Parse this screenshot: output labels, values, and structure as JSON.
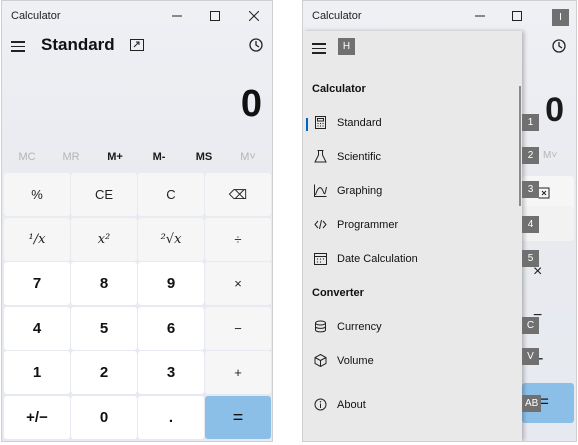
{
  "left": {
    "title": "Calculator",
    "mode": "Standard",
    "display": "0",
    "memory": [
      {
        "label": "MC",
        "enabled": false
      },
      {
        "label": "MR",
        "enabled": false
      },
      {
        "label": "M+",
        "enabled": true
      },
      {
        "label": "M-",
        "enabled": true
      },
      {
        "label": "MS",
        "enabled": true
      },
      {
        "label": "M˅",
        "enabled": false
      }
    ],
    "keys": [
      [
        "%",
        "CE",
        "C",
        "⌫"
      ],
      [
        "¹∕x",
        "x²",
        "²√x",
        "÷"
      ],
      [
        "7",
        "8",
        "9",
        "×"
      ],
      [
        "4",
        "5",
        "6",
        "−"
      ],
      [
        "1",
        "2",
        "3",
        "+"
      ],
      [
        "+/−",
        "0",
        ".",
        "="
      ]
    ]
  },
  "right": {
    "title": "Calculator",
    "display": "0",
    "mem_label": "M˅",
    "nav": {
      "sections": {
        "calculator": "Calculator",
        "converter": "Converter"
      },
      "items": [
        {
          "label": "Standard",
          "icon": "standard-calculator-icon",
          "selected": true
        },
        {
          "label": "Scientific",
          "icon": "flask-icon"
        },
        {
          "label": "Graphing",
          "icon": "graph-icon"
        },
        {
          "label": "Programmer",
          "icon": "code-icon"
        },
        {
          "label": "Date Calculation",
          "icon": "calendar-icon"
        }
      ],
      "converter_items": [
        {
          "label": "Currency",
          "icon": "coins-icon"
        },
        {
          "label": "Volume",
          "icon": "cube-icon"
        }
      ],
      "about": "About"
    },
    "badges": {
      "close": "I",
      "hamburger": "H",
      "b1": "1",
      "b2": "2",
      "b3": "3",
      "b4": "4",
      "b5": "5",
      "bC": "C",
      "bV": "V",
      "bAB": "AB"
    },
    "key_glyphs": {
      "times": "×",
      "minus": "−",
      "plus": "+",
      "equals": "="
    }
  },
  "colors": {
    "accent": "#0067c0",
    "equals": "#8cbfe8",
    "nav_bg": "#e9e9e9"
  }
}
